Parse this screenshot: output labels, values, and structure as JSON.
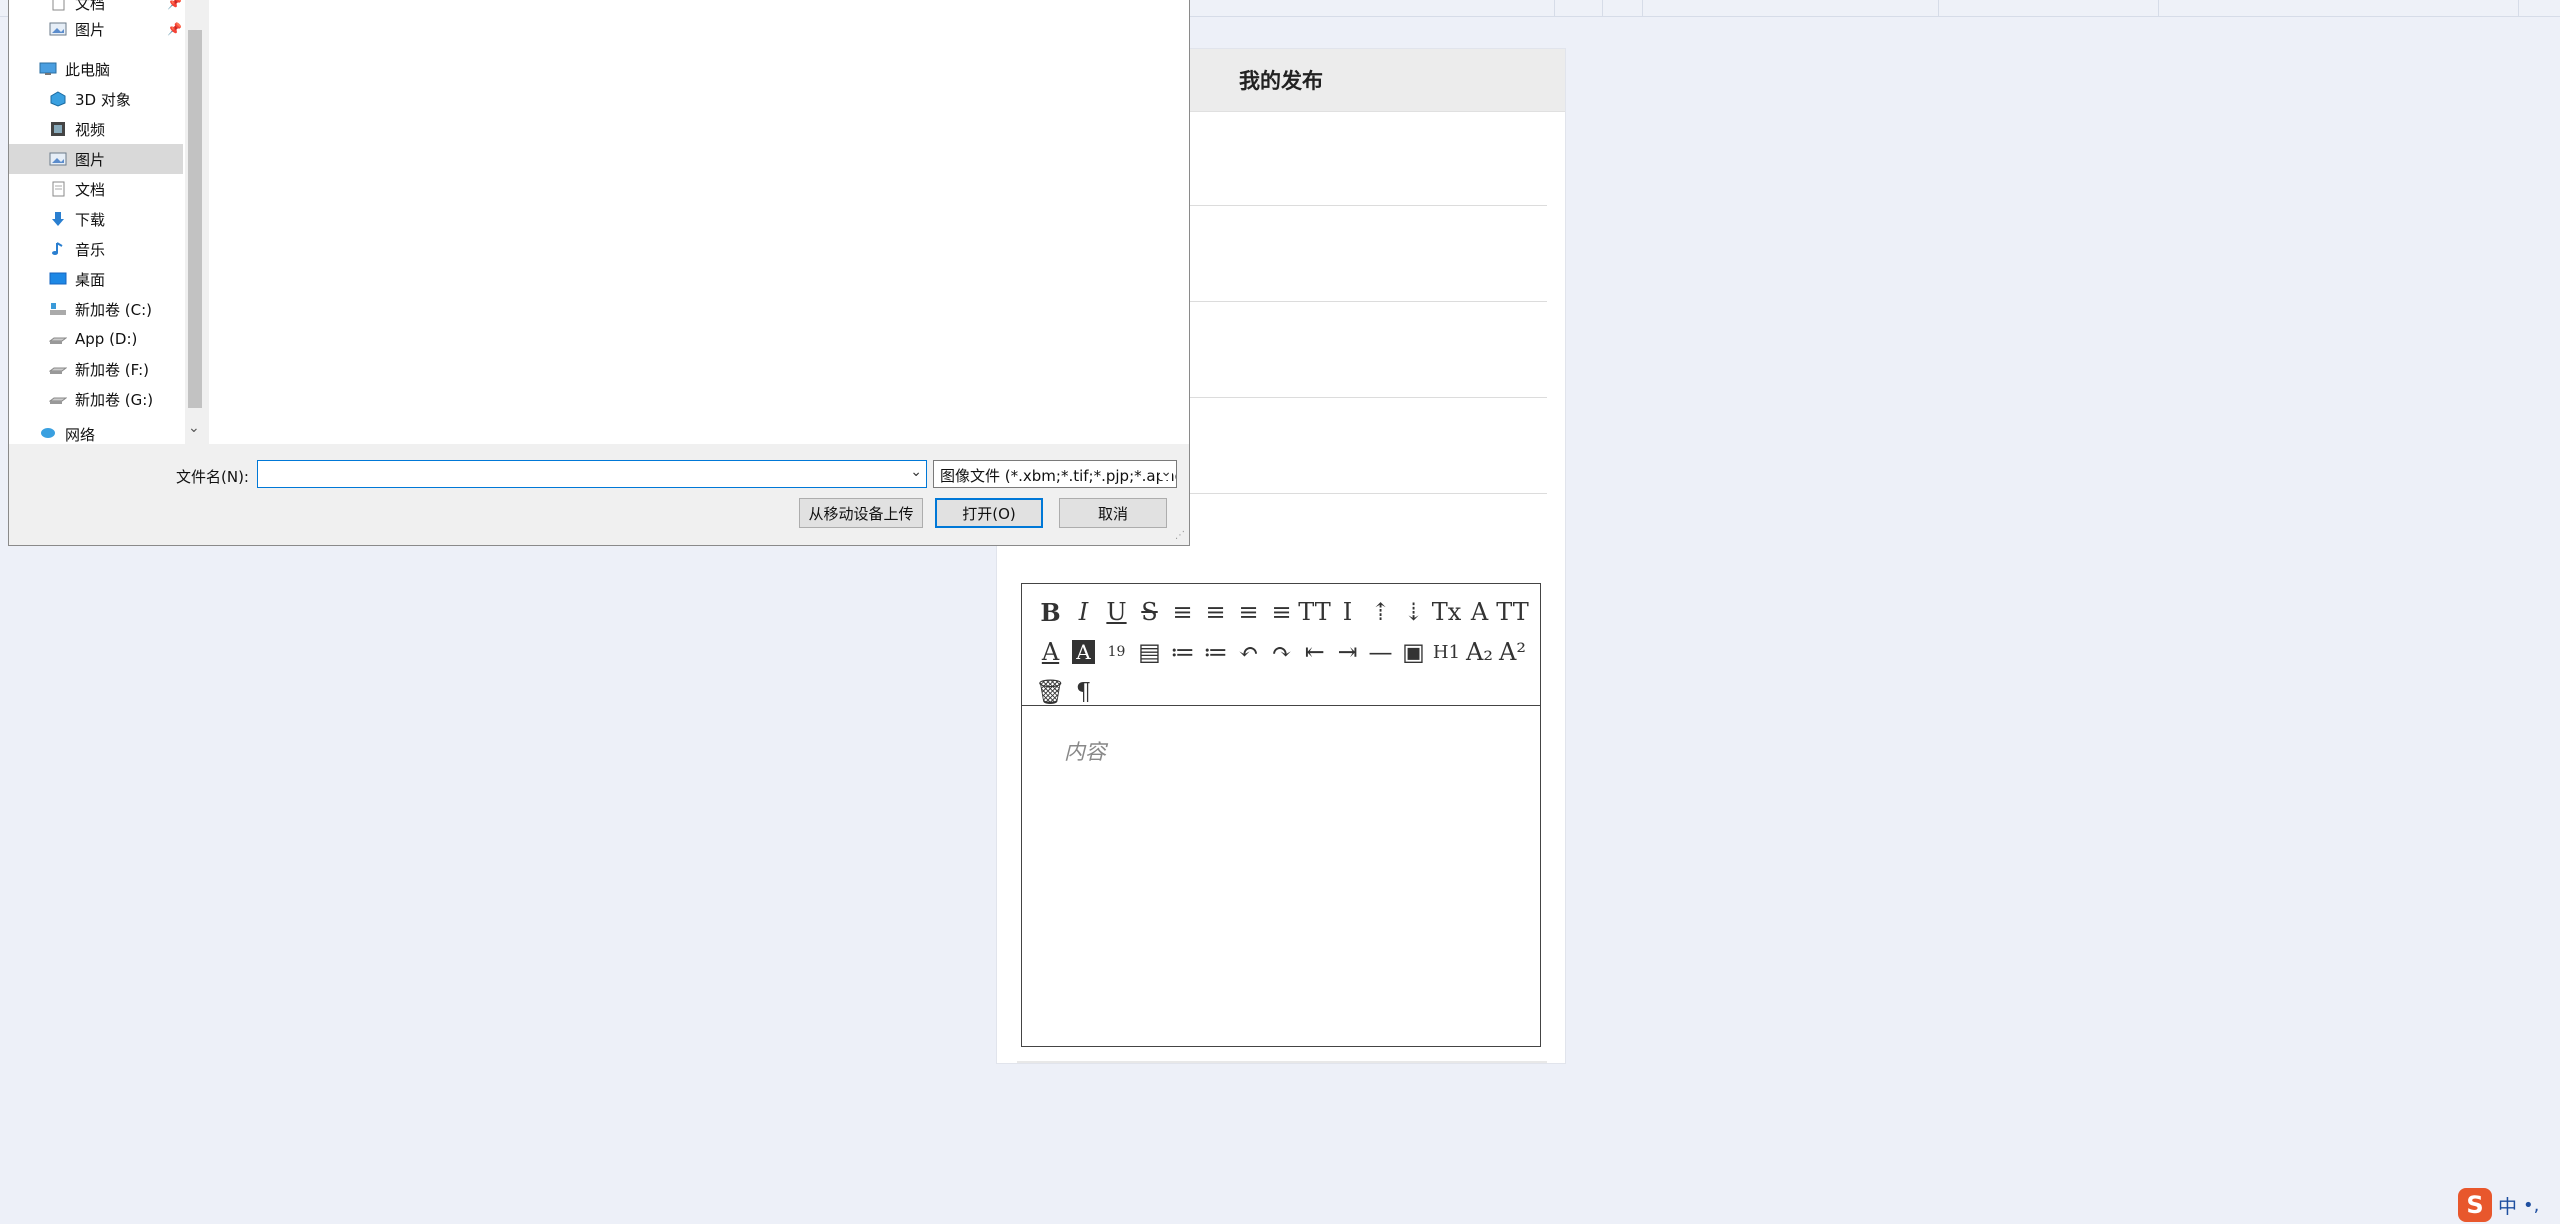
{
  "panel": {
    "title": "我的发布"
  },
  "editor": {
    "placeholder": "内容",
    "toolbar_row1": [
      "B",
      "I",
      "U",
      "S",
      "≡",
      "≡",
      "≡",
      "≡",
      "TT",
      "I",
      "⇡",
      "⇣",
      "Tx",
      "A",
      "TT"
    ],
    "toolbar_row2": [
      "A",
      "A",
      "19",
      "▤",
      "≔",
      "≔",
      "↶",
      "↷",
      "⇤",
      "⇥",
      "—",
      "▣",
      "H1",
      "A₂",
      "A²"
    ],
    "toolbar_row3": [
      "🗑",
      "¶"
    ]
  },
  "dialog": {
    "nav": [
      {
        "label": "文档",
        "icon": "document-icon",
        "pinned": true
      },
      {
        "label": "图片",
        "icon": "pictures-icon",
        "pinned": true
      },
      {
        "label": "此电脑",
        "icon": "computer-icon"
      },
      {
        "label": "3D 对象",
        "icon": "3d-objects-icon"
      },
      {
        "label": "视频",
        "icon": "video-icon"
      },
      {
        "label": "图片",
        "icon": "pictures-icon",
        "selected": true
      },
      {
        "label": "文档",
        "icon": "document-icon"
      },
      {
        "label": "下载",
        "icon": "download-icon"
      },
      {
        "label": "音乐",
        "icon": "music-icon"
      },
      {
        "label": "桌面",
        "icon": "desktop-icon"
      },
      {
        "label": "新加卷 (C:)",
        "icon": "drive-icon"
      },
      {
        "label": "App (D:)",
        "icon": "drive-icon"
      },
      {
        "label": "新加卷 (F:)",
        "icon": "drive-icon"
      },
      {
        "label": "新加卷 (G:)",
        "icon": "drive-icon"
      },
      {
        "label": "网络",
        "icon": "network-icon"
      }
    ],
    "filename_label": "文件名(N):",
    "filename_value": "",
    "filetype": "图像文件 (*.xbm;*.tif;*.pjp;*.apng",
    "mobile_upload_label": "从移动设备上传",
    "open_label": "打开(O)",
    "cancel_label": "取消"
  },
  "ime": {
    "logo": "S",
    "lang": "中",
    "punct": "•,"
  }
}
